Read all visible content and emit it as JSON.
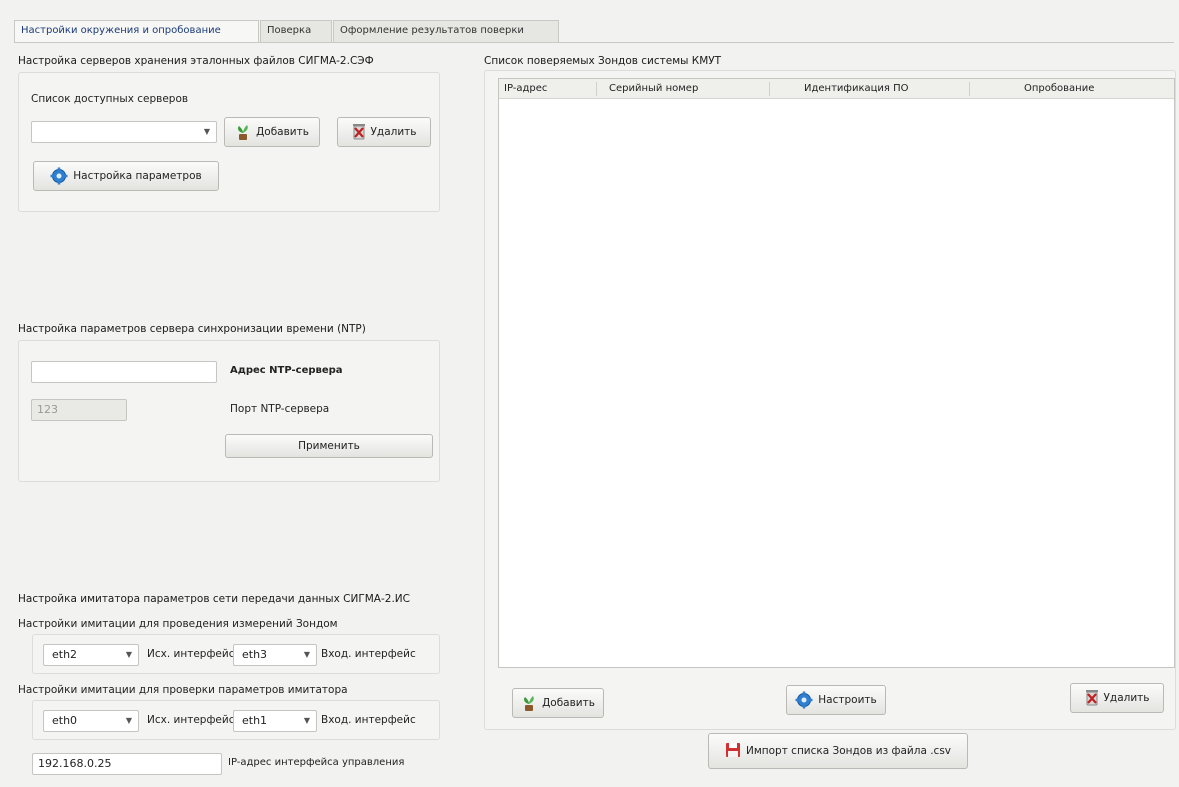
{
  "tabs": [
    {
      "label": "Настройки окружения и опробование",
      "active": true
    },
    {
      "label": "Поверка",
      "active": false
    },
    {
      "label": "Оформление результатов поверки",
      "active": false
    }
  ],
  "servers": {
    "title": "Настройка серверов хранения эталонных файлов СИГМА-2.СЭФ",
    "list_label": "Список доступных серверов",
    "combo_value": "",
    "add_label": "Добавить",
    "delete_label": "Удалить",
    "settings_label": "Настройка параметров"
  },
  "ntp": {
    "title": "Настройка параметров сервера синхронизации времени (NTP)",
    "address_value": "",
    "address_label": "Адрес NTP-сервера",
    "port_value": "123",
    "port_label": "Порт NTP-сервера",
    "apply_label": "Применить"
  },
  "imitator": {
    "title": "Настройка имитатора параметров сети передачи данных СИГМА-2.ИС",
    "meas_title": "Настройки имитации для проведения измерений Зондом",
    "meas_out_value": "eth2",
    "meas_out_label": "Исх. интерфейс",
    "meas_in_value": "eth3",
    "meas_in_label": "Вход. интерфейс",
    "check_title": "Настройки имитации для проверки параметров имитатора",
    "check_out_value": "eth0",
    "check_out_label": "Исх. интерфейс",
    "check_in_value": "eth1",
    "check_in_label": "Вход. интерфейс",
    "ip_value": "192.168.0.25",
    "ip_label": "IP-адрес интерфейса управления"
  },
  "probes": {
    "title": "Список поверяемых Зондов системы КМУТ",
    "columns": [
      "IP-адрес",
      "Серийный номер",
      "Идентификация ПО",
      "Опробование"
    ],
    "rows": [],
    "add_label": "Добавить",
    "configure_label": "Настроить",
    "delete_label": "Удалить",
    "import_label": "Импорт списка Зондов из файла .csv"
  },
  "colors": {
    "active_tab_text": "#1a3a7a",
    "window_bg": "#f2f2f0",
    "gear_blue": "#2f7fd0",
    "delete_red": "#c02020",
    "plant_green": "#3a9a3a"
  }
}
